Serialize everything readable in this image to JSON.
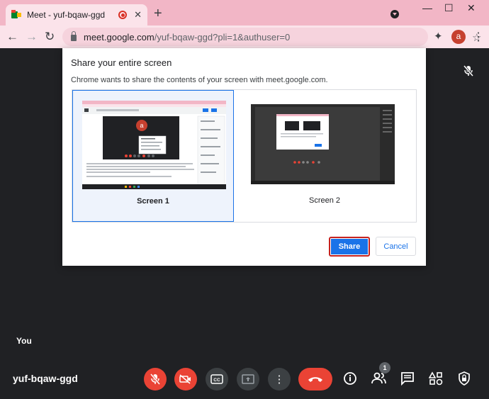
{
  "browser": {
    "tab_title": "Meet - yuf-bqaw-ggd",
    "tab_close": "✕",
    "new_tab": "+",
    "window_controls": {
      "minimize": "—",
      "maximize": "☐",
      "close": "✕"
    },
    "url_host": "meet.google.com",
    "url_rest": "/yuf-bqaw-ggd?pli=1&authuser=0",
    "nav": {
      "back": "←",
      "forward": "→",
      "reload": "↻"
    },
    "avatar_letter": "a",
    "star": "☆",
    "extensions": "✦",
    "menu": "⋮"
  },
  "dialog": {
    "title": "Share your entire screen",
    "subtitle": "Chrome wants to share the contents of your screen with meet.google.com.",
    "screens": [
      {
        "label": "Screen 1",
        "selected": true
      },
      {
        "label": "Screen 2",
        "selected": false
      }
    ],
    "thumb_avatar_letter": "a",
    "share_label": "Share",
    "cancel_label": "Cancel"
  },
  "meet": {
    "self_label": "You",
    "meeting_code": "yuf-bqaw-ggd",
    "participants_count": "1",
    "muted_icon": "🎙"
  },
  "colors": {
    "tab_strip": "#f2b6c6",
    "toolbar": "#fbe3ea",
    "meet_background": "#202124",
    "accent": "#1a73e8",
    "danger": "#ea4335"
  }
}
